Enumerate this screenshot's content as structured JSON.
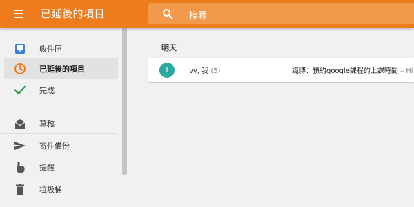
{
  "header": {
    "title": "已延後的項目",
    "menu_icon": "hamburger-menu-icon",
    "background": "#ee7b1c"
  },
  "search": {
    "placeholder": "搜尋",
    "icon": "search-icon"
  },
  "sidebar": {
    "items": [
      {
        "label": "收件匣",
        "icon": "inbox-icon",
        "color": "#3b7ddd"
      },
      {
        "label": "已延後的項目",
        "icon": "clock-icon",
        "color": "#ee7b1c",
        "active": true
      },
      {
        "label": "完成",
        "icon": "check-icon",
        "color": "#2e9a49"
      },
      {
        "label": "草稿",
        "icon": "drafts-icon",
        "color": "#555555"
      },
      {
        "label": "寄件備份",
        "icon": "send-icon",
        "color": "#555555"
      },
      {
        "label": "提醒",
        "icon": "reminder-icon",
        "color": "#555555"
      },
      {
        "label": "垃圾桶",
        "icon": "trash-icon",
        "color": "#555555"
      }
    ]
  },
  "main": {
    "section_label": "明天",
    "emails": [
      {
        "avatar_letter": "I",
        "avatar_color": "#2da79f",
        "sender": "Ivy, 我",
        "count": "(5)",
        "subject": "識博：預約google課程的上課時間",
        "snippet": " – Hi"
      }
    ]
  }
}
